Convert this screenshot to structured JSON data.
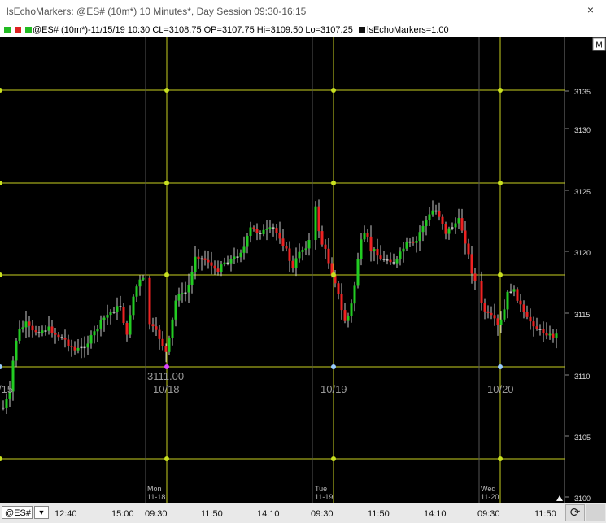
{
  "window": {
    "title": "lsEchoMarkers: @ES# (10m*) 10 Minutes*, Day Session 09:30-16:15",
    "close_glyph": "×"
  },
  "infobar": {
    "symbol_line": "@ES# (10m*)-11/15/19 10:30 CL=3108.75 OP=3107.75 Hi=3109.50 Lo=3107.25",
    "indicator": "lsEchoMarkers=1.00",
    "colors": {
      "green_square": "#22bb22",
      "red_square": "#dd2222",
      "black_square": "#111111"
    }
  },
  "chart": {
    "colors": {
      "background": "#000000",
      "up": "#22cc22",
      "down": "#ee2222",
      "neutral": "#c8c8c8",
      "grid": "#c8d020",
      "marker": "#c8e020",
      "blue_marker": "#99ccff",
      "magenta_marker": "#dd44ff"
    },
    "price_labels": [
      "3135",
      "3130",
      "3125",
      "3120",
      "3115",
      "3110",
      "3105",
      "3100"
    ],
    "corner_label": "M",
    "annotation": "3111.00",
    "date_labels": [
      "/15",
      "10/18",
      "10/19",
      "10/20"
    ],
    "day_labels": [
      {
        "day": "Mon",
        "date": "11-18"
      },
      {
        "day": "Tue",
        "date": "11-19"
      },
      {
        "day": "Wed",
        "date": "11-20"
      }
    ]
  },
  "bottombar": {
    "symbol": "@ES#",
    "dropdown_glyph": "▼",
    "time_labels": [
      "12:40",
      "15:00",
      "09:30",
      "11:50",
      "14:10",
      "09:30",
      "11:50",
      "14:10",
      "09:30",
      "11:50"
    ],
    "reload_glyph": "⟳"
  }
}
